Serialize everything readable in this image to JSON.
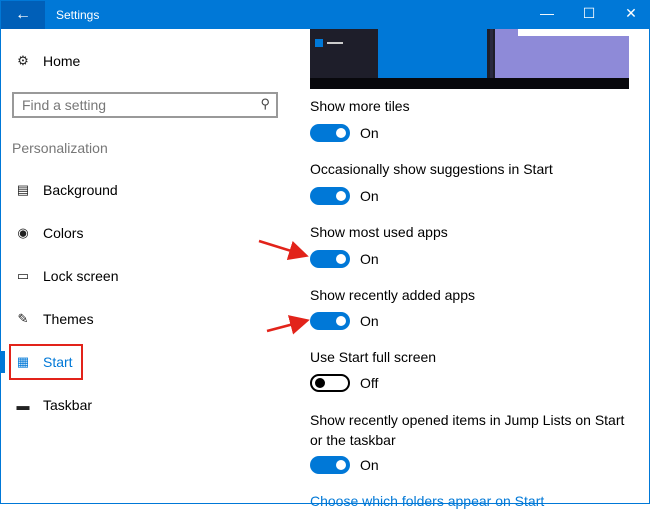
{
  "window": {
    "title": "Settings",
    "accent": "#0078d7"
  },
  "sidebar": {
    "home": "Home",
    "search_placeholder": "Find a setting",
    "section": "Personalization",
    "items": [
      {
        "label": "Background",
        "icon": "picture-icon"
      },
      {
        "label": "Colors",
        "icon": "palette-icon"
      },
      {
        "label": "Lock screen",
        "icon": "lock-screen-icon"
      },
      {
        "label": "Themes",
        "icon": "brush-icon"
      },
      {
        "label": "Start",
        "icon": "start-icon",
        "selected": true
      },
      {
        "label": "Taskbar",
        "icon": "taskbar-icon"
      }
    ]
  },
  "settings": [
    {
      "label": "Show more tiles",
      "state": "On",
      "on": true
    },
    {
      "label": "Occasionally show suggestions in Start",
      "state": "On",
      "on": true
    },
    {
      "label": "Show most used apps",
      "state": "On",
      "on": true
    },
    {
      "label": "Show recently added apps",
      "state": "On",
      "on": true
    },
    {
      "label": "Use Start full screen",
      "state": "Off",
      "on": false
    },
    {
      "label": "Show recently opened items in Jump Lists on Start or the taskbar",
      "state": "On",
      "on": true
    }
  ],
  "link": "Choose which folders appear on Start"
}
